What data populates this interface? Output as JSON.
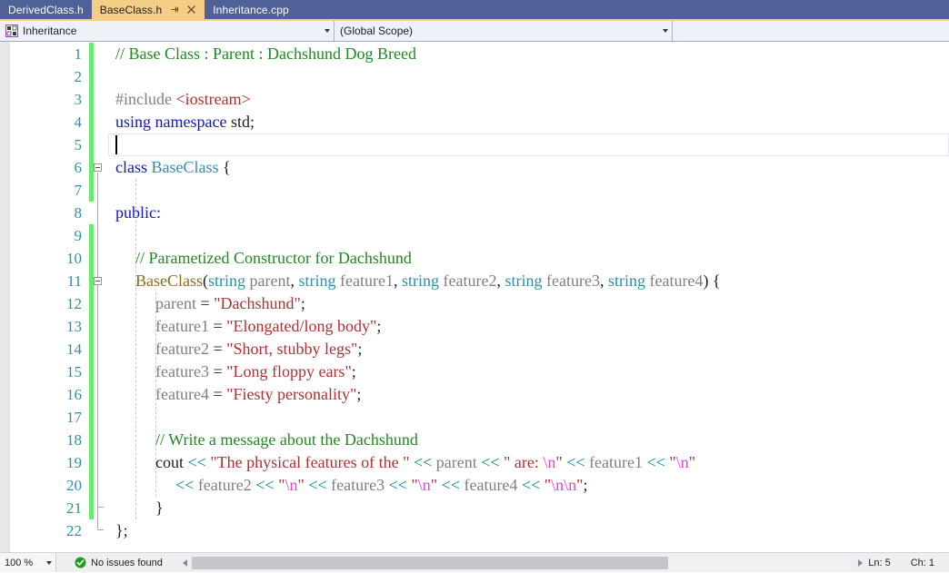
{
  "tabs": [
    {
      "label": "DerivedClass.h",
      "active": false
    },
    {
      "label": "BaseClass.h",
      "active": true,
      "pin_icon": "pin-icon",
      "close_icon": "close-icon"
    },
    {
      "label": "Inheritance.cpp",
      "active": false
    }
  ],
  "navbar": {
    "project_icon": "class-selector-icon",
    "project": "Inheritance",
    "scope": "(Global Scope)",
    "dropdown_icon": "chevron-down-icon"
  },
  "editor": {
    "line_numbers": [
      1,
      2,
      3,
      4,
      5,
      6,
      7,
      8,
      9,
      10,
      11,
      12,
      13,
      14,
      15,
      16,
      17,
      18,
      19,
      20,
      21,
      22
    ],
    "current_line": 5,
    "caret_line": 5,
    "lines": [
      {
        "n": 1,
        "indent": 0,
        "tokens": [
          {
            "t": "comment",
            "s": "// Base Class : Parent : Dachshund Dog Breed"
          }
        ]
      },
      {
        "n": 2,
        "indent": 0,
        "tokens": []
      },
      {
        "n": 3,
        "indent": 0,
        "tokens": [
          {
            "t": "preproc",
            "s": "#include "
          },
          {
            "t": "string",
            "s": "<iostream>"
          }
        ]
      },
      {
        "n": 4,
        "indent": 0,
        "tokens": [
          {
            "t": "keyword",
            "s": "using namespace "
          },
          {
            "t": "plain",
            "s": "std;"
          }
        ]
      },
      {
        "n": 5,
        "indent": 0,
        "tokens": []
      },
      {
        "n": 6,
        "indent": 0,
        "tokens": [
          {
            "t": "keyword",
            "s": "class "
          },
          {
            "t": "type",
            "s": "BaseClass"
          },
          {
            "t": "plain",
            "s": " {"
          }
        ]
      },
      {
        "n": 7,
        "indent": 1,
        "tokens": []
      },
      {
        "n": 8,
        "indent": 0,
        "tokens": [
          {
            "t": "keyword",
            "s": "public:"
          }
        ]
      },
      {
        "n": 9,
        "indent": 1,
        "tokens": []
      },
      {
        "n": 10,
        "indent": 1,
        "tokens": [
          {
            "t": "comment",
            "s": "// Parametized Constructor for Dachshund"
          }
        ]
      },
      {
        "n": 11,
        "indent": 1,
        "tokens": [
          {
            "t": "func",
            "s": "BaseClass"
          },
          {
            "t": "plain",
            "s": "("
          },
          {
            "t": "type",
            "s": "string"
          },
          {
            "t": "ident",
            "s": " parent"
          },
          {
            "t": "plain",
            "s": ", "
          },
          {
            "t": "type",
            "s": "string"
          },
          {
            "t": "ident",
            "s": " feature1"
          },
          {
            "t": "plain",
            "s": ", "
          },
          {
            "t": "type",
            "s": "string"
          },
          {
            "t": "ident",
            "s": " feature2"
          },
          {
            "t": "plain",
            "s": ", "
          },
          {
            "t": "type",
            "s": "string"
          },
          {
            "t": "ident",
            "s": " feature3"
          },
          {
            "t": "plain",
            "s": ", "
          },
          {
            "t": "type",
            "s": "string"
          },
          {
            "t": "ident",
            "s": " feature4"
          },
          {
            "t": "plain",
            "s": ") {"
          }
        ]
      },
      {
        "n": 12,
        "indent": 2,
        "tokens": [
          {
            "t": "ident",
            "s": "parent "
          },
          {
            "t": "plain",
            "s": "= "
          },
          {
            "t": "string",
            "s": "\"Dachshund\""
          },
          {
            "t": "plain",
            "s": ";"
          }
        ]
      },
      {
        "n": 13,
        "indent": 2,
        "tokens": [
          {
            "t": "ident",
            "s": "feature1 "
          },
          {
            "t": "plain",
            "s": "= "
          },
          {
            "t": "string",
            "s": "\"Elongated/long body\""
          },
          {
            "t": "plain",
            "s": ";"
          }
        ]
      },
      {
        "n": 14,
        "indent": 2,
        "tokens": [
          {
            "t": "ident",
            "s": "feature2 "
          },
          {
            "t": "plain",
            "s": "= "
          },
          {
            "t": "string",
            "s": "\"Short, stubby legs\""
          },
          {
            "t": "plain",
            "s": ";"
          }
        ]
      },
      {
        "n": 15,
        "indent": 2,
        "tokens": [
          {
            "t": "ident",
            "s": "feature3 "
          },
          {
            "t": "plain",
            "s": "= "
          },
          {
            "t": "string",
            "s": "\"Long floppy ears\""
          },
          {
            "t": "plain",
            "s": ";"
          }
        ]
      },
      {
        "n": 16,
        "indent": 2,
        "tokens": [
          {
            "t": "ident",
            "s": "feature4 "
          },
          {
            "t": "plain",
            "s": "= "
          },
          {
            "t": "string",
            "s": "\"Fiesty personality\""
          },
          {
            "t": "plain",
            "s": ";"
          }
        ]
      },
      {
        "n": 17,
        "indent": 2,
        "tokens": []
      },
      {
        "n": 18,
        "indent": 2,
        "tokens": [
          {
            "t": "comment",
            "s": "// Write a message about the Dachshund"
          }
        ]
      },
      {
        "n": 19,
        "indent": 2,
        "tokens": [
          {
            "t": "plain",
            "s": "cout "
          },
          {
            "t": "op",
            "s": "<< "
          },
          {
            "t": "string",
            "s": "\"The physical features of the \" "
          },
          {
            "t": "op",
            "s": "<< "
          },
          {
            "t": "ident",
            "s": "parent "
          },
          {
            "t": "op",
            "s": "<< "
          },
          {
            "t": "string",
            "s": "\" are: "
          },
          {
            "t": "escape",
            "s": "\\n"
          },
          {
            "t": "string",
            "s": "\" "
          },
          {
            "t": "op",
            "s": "<< "
          },
          {
            "t": "ident",
            "s": "feature1 "
          },
          {
            "t": "op",
            "s": "<< "
          },
          {
            "t": "string",
            "s": "\""
          },
          {
            "t": "escape",
            "s": "\\n"
          },
          {
            "t": "string",
            "s": "\""
          }
        ]
      },
      {
        "n": 20,
        "indent": 3,
        "tokens": [
          {
            "t": "op",
            "s": "<< "
          },
          {
            "t": "ident",
            "s": "feature2 "
          },
          {
            "t": "op",
            "s": "<< "
          },
          {
            "t": "string",
            "s": "\""
          },
          {
            "t": "escape",
            "s": "\\n"
          },
          {
            "t": "string",
            "s": "\" "
          },
          {
            "t": "op",
            "s": "<< "
          },
          {
            "t": "ident",
            "s": "feature3 "
          },
          {
            "t": "op",
            "s": "<< "
          },
          {
            "t": "string",
            "s": "\""
          },
          {
            "t": "escape",
            "s": "\\n"
          },
          {
            "t": "string",
            "s": "\" "
          },
          {
            "t": "op",
            "s": "<< "
          },
          {
            "t": "ident",
            "s": "feature4 "
          },
          {
            "t": "op",
            "s": "<< "
          },
          {
            "t": "string",
            "s": "\""
          },
          {
            "t": "escape",
            "s": "\\n\\n"
          },
          {
            "t": "string",
            "s": "\""
          },
          {
            "t": "plain",
            "s": ";"
          }
        ]
      },
      {
        "n": 21,
        "indent": 2,
        "tokens": [
          {
            "t": "plain",
            "s": "}"
          }
        ]
      },
      {
        "n": 22,
        "indent": 0,
        "tokens": [
          {
            "t": "plain",
            "s": "};"
          }
        ]
      }
    ]
  },
  "statusbar": {
    "zoom": "100 %",
    "zoom_arrow_icon": "chevron-down-icon",
    "issues_icon": "check-circle-icon",
    "issues": "No issues found",
    "scroll_left_icon": "triangle-left-icon",
    "scroll_right_icon": "triangle-right-icon",
    "line_label": "Ln: 5",
    "col_label": "Ch: 1"
  },
  "colors": {
    "tab_active_bg": "#f5cd85",
    "tab_strip_bg": "#4f6196",
    "comment": "#1f8a1f",
    "keyword": "#1413d4",
    "string": "#b03030",
    "escape": "#e542e5",
    "type": "#2b91af",
    "identifier": "#808080",
    "operator": "#008b8b",
    "function": "#8a6d1f",
    "linenumber": "#2b91af",
    "changebar": "#6ce86c"
  }
}
